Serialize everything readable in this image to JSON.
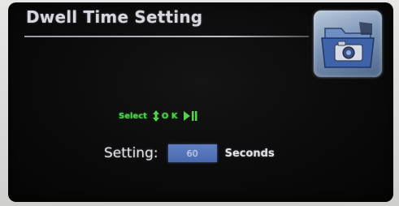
{
  "screen": {
    "title": "Dwell Time Setting"
  },
  "app_icon": {
    "icon_name": "camera-folder-icon"
  },
  "hint": {
    "select_label": "Select",
    "ok_label": "O K",
    "select_icon": "up-down-arrows-icon",
    "ok_icon": "play-pause-icon",
    "color": "#4fd44a"
  },
  "setting": {
    "label": "Setting:",
    "value": "60",
    "unit": "Seconds",
    "value_box_color": "#5272b7"
  }
}
